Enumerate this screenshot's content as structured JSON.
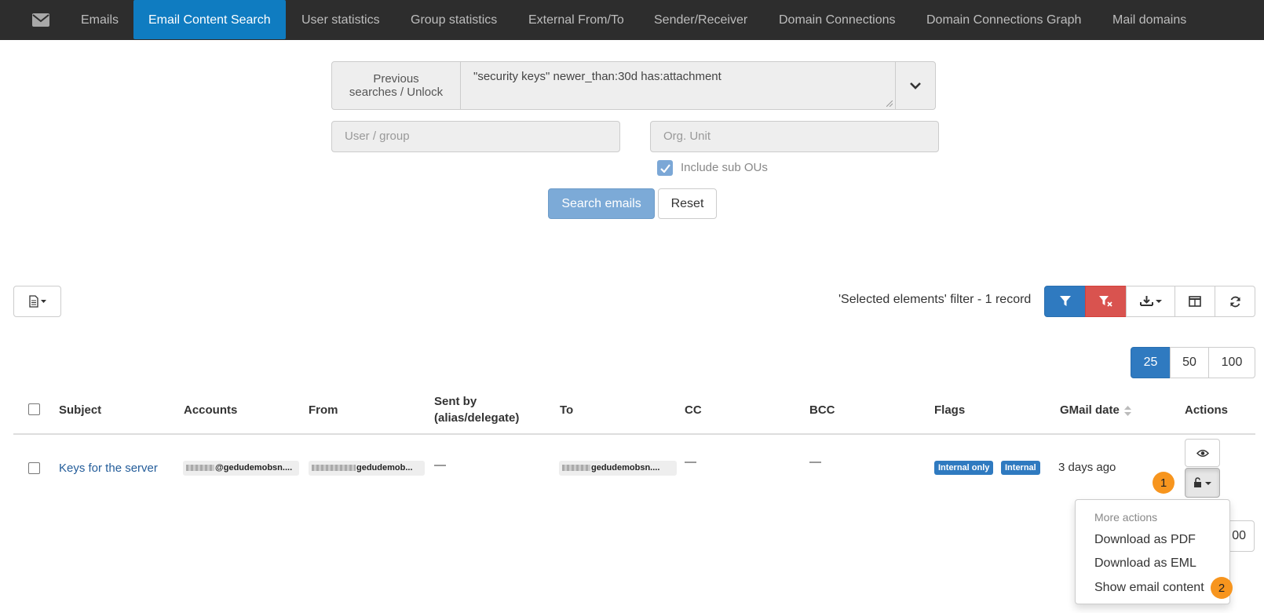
{
  "nav": {
    "home_icon": "envelope-icon",
    "items": [
      {
        "label": "Emails"
      },
      {
        "label": "Email Content Search",
        "active": true
      },
      {
        "label": "User statistics"
      },
      {
        "label": "Group statistics"
      },
      {
        "label": "External From/To"
      },
      {
        "label": "Sender/Receiver"
      },
      {
        "label": "Domain Connections"
      },
      {
        "label": "Domain Connections Graph"
      },
      {
        "label": "Mail domains"
      }
    ]
  },
  "search": {
    "prev_label": "Previous searches / Unlock",
    "query": "\"security keys\" newer_than:30d has:attachment",
    "user_group_placeholder": "User / group",
    "org_unit_placeholder": "Org. Unit",
    "include_sub_ous_label": "Include sub OUs",
    "include_sub_ous_checked": true,
    "search_button": "Search emails",
    "reset_button": "Reset"
  },
  "toolbar": {
    "filter_text": "'Selected elements' filter -  1 record",
    "colors": {
      "primary": "#2f7ac0",
      "danger": "#d9534f"
    }
  },
  "pagination": {
    "sizes": [
      "25",
      "50",
      "100"
    ],
    "selected": "25"
  },
  "table": {
    "headers": {
      "subject": "Subject",
      "accounts": "Accounts",
      "from": "From",
      "sent_by": "Sent by (alias/delegate)",
      "to": "To",
      "cc": "CC",
      "bcc": "BCC",
      "flags": "Flags",
      "gmail_date": "GMail date",
      "actions": "Actions"
    },
    "rows": [
      {
        "subject": "Keys for the server",
        "accounts": "@gedudemobsn....",
        "from": "gedudemob...",
        "sent_by": "—",
        "to": "gedudemobsn....",
        "cc": "—",
        "bcc": "—",
        "flags": [
          "Internal only",
          "Internal"
        ],
        "date": "3 days ago"
      }
    ]
  },
  "dropdown": {
    "header": "More actions",
    "items": [
      "Download as PDF",
      "Download as EML",
      "Show email content"
    ]
  },
  "callouts": [
    "1",
    "2"
  ],
  "bottom_pagination_partial": "00"
}
